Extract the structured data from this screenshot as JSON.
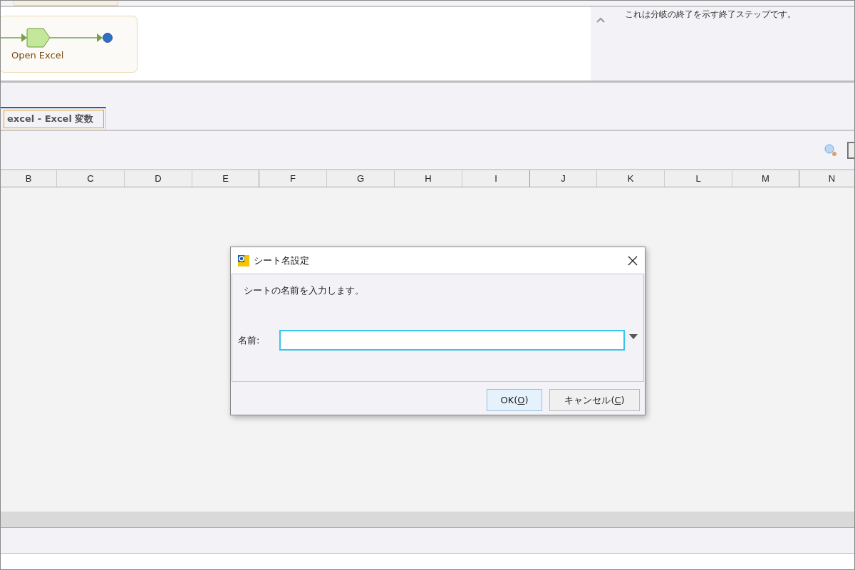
{
  "flow": {
    "step_label": "Open Excel"
  },
  "description": "これは分岐の終了を示す終了ステップです。",
  "tabs": [
    {
      "label": "excel - Excel 変数",
      "selected": true
    }
  ],
  "columns": [
    "B",
    "C",
    "D",
    "E",
    "F",
    "G",
    "H",
    "I",
    "J",
    "K",
    "L",
    "M",
    "N"
  ],
  "dialog": {
    "title": "シート名設定",
    "message": "シートの名前を入力します。",
    "field_label": "名前:",
    "buttons": [
      {
        "label": "OK(**O**)",
        "kind": "default"
      },
      {
        "label": "キャンセル(**C**)",
        "kind": "normal"
      }
    ]
  }
}
